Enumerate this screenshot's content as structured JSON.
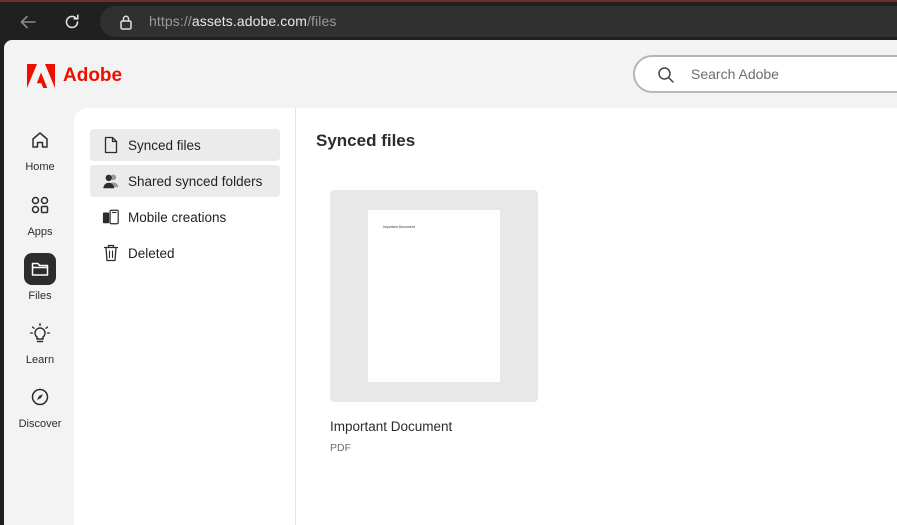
{
  "browser": {
    "url_scheme": "https://",
    "url_host": "assets.adobe.com",
    "url_path": "/files"
  },
  "header": {
    "logo_text": "Adobe",
    "brand_color": "#eb1000",
    "search_placeholder": "Search Adobe"
  },
  "rail": {
    "items": [
      {
        "label": "Home",
        "icon": "home-icon",
        "active": false
      },
      {
        "label": "Apps",
        "icon": "apps-icon",
        "active": false
      },
      {
        "label": "Files",
        "icon": "folder-icon",
        "active": true
      },
      {
        "label": "Learn",
        "icon": "lightbulb-icon",
        "active": false
      },
      {
        "label": "Discover",
        "icon": "compass-icon",
        "active": false
      }
    ]
  },
  "subnav": {
    "items": [
      {
        "label": "Synced files",
        "icon": "document-icon",
        "selected": true
      },
      {
        "label": "Shared synced folders",
        "icon": "people-icon",
        "selected": true
      },
      {
        "label": "Mobile creations",
        "icon": "mobile-creations-icon",
        "selected": false
      },
      {
        "label": "Deleted",
        "icon": "trash-icon",
        "selected": false
      }
    ]
  },
  "main": {
    "title": "Synced files",
    "files": [
      {
        "name": "Important Document",
        "type": "PDF",
        "thumbnail_text": "Important Document"
      }
    ]
  }
}
